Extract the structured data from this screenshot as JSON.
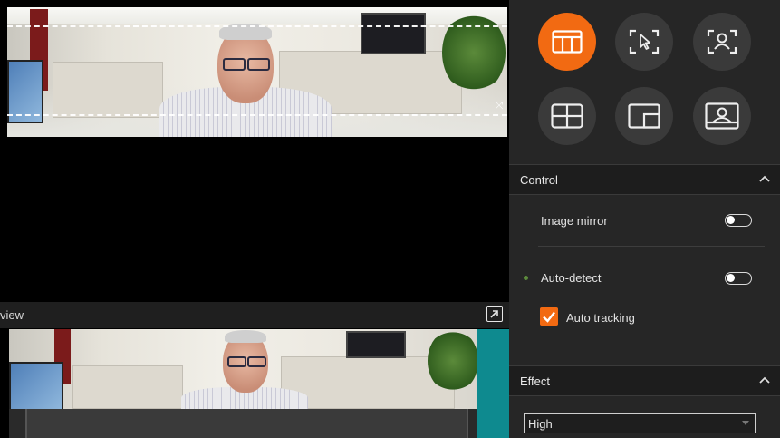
{
  "preview": {
    "label": "view"
  },
  "panel": {
    "mode_buttons": [
      {
        "icon": "table-layout-icon",
        "active": true
      },
      {
        "icon": "select-region-icon",
        "active": false
      },
      {
        "icon": "person-frame-icon",
        "active": false
      },
      {
        "icon": "grid-four-icon",
        "active": false
      },
      {
        "icon": "picture-in-picture-icon",
        "active": false
      },
      {
        "icon": "presenter-frame-icon",
        "active": false
      }
    ],
    "control": {
      "title": "Control",
      "image_mirror": {
        "label": "Image mirror",
        "on": false
      },
      "auto_detect": {
        "label": "Auto-detect",
        "on": false
      },
      "auto_tracking": {
        "label": "Auto tracking",
        "checked": true
      }
    },
    "effect": {
      "title": "Effect",
      "select_value": "High"
    }
  },
  "colors": {
    "accent": "#f26a12",
    "panel_bg": "#262626",
    "preview_frame": "#0e8a8f"
  }
}
